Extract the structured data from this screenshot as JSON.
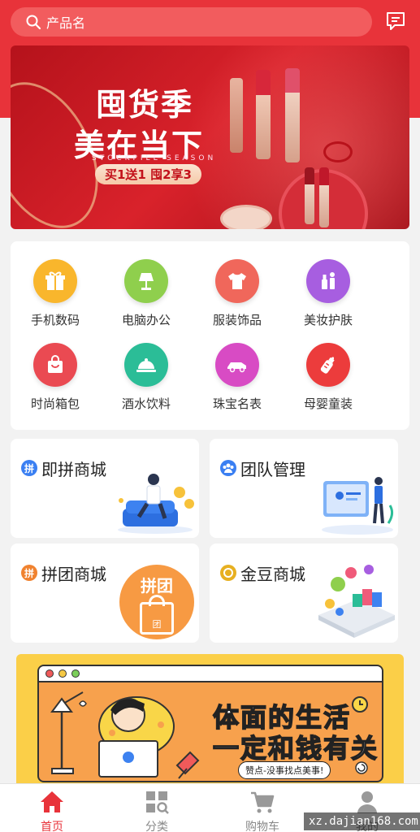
{
  "search": {
    "placeholder": "产品名"
  },
  "banner": {
    "title_line1": "囤货季",
    "title_line2": "美在当下",
    "subtitle": "STOCKPILE SEASON",
    "promo": "买1送1 囤2享3"
  },
  "categories": [
    {
      "label": "手机数码",
      "icon": "gift-icon",
      "color": "#f9b62c"
    },
    {
      "label": "电脑办公",
      "icon": "lamp-icon",
      "color": "#8fcf4d"
    },
    {
      "label": "服装饰品",
      "icon": "tshirt-icon",
      "color": "#f0675b"
    },
    {
      "label": "美妆护肤",
      "icon": "cosmetics-icon",
      "color": "#a75ee0"
    },
    {
      "label": "时尚箱包",
      "icon": "bag-icon",
      "color": "#ea4a52"
    },
    {
      "label": "酒水饮料",
      "icon": "cloche-icon",
      "color": "#2bbd97"
    },
    {
      "label": "珠宝名表",
      "icon": "car-icon",
      "color": "#d84bc4"
    },
    {
      "label": "母婴童装",
      "icon": "bottle-icon",
      "color": "#ec3c3c"
    }
  ],
  "features": [
    {
      "title": "即拼商城",
      "badge": "拼",
      "badge_color": "#3a7ff2"
    },
    {
      "title": "团队管理",
      "badge": "●",
      "badge_color": "#3a7ff2"
    },
    {
      "title": "拼团商城",
      "badge": "拼",
      "badge_color": "#f0822f",
      "illustration_text": "拼团",
      "bag_text": "团"
    },
    {
      "title": "金豆商城",
      "badge": "●",
      "badge_color": "#e7b021"
    }
  ],
  "ad": {
    "line1": "体面的生活",
    "line2": "一定和钱有关",
    "tag": "赞点-没事找点美事!"
  },
  "tabbar": {
    "items": [
      {
        "label": "首页",
        "icon": "home-icon",
        "active": true
      },
      {
        "label": "分类",
        "icon": "category-icon",
        "active": false
      },
      {
        "label": "购物车",
        "icon": "cart-icon",
        "active": false
      },
      {
        "label": "我的",
        "icon": "user-icon",
        "active": false
      }
    ]
  },
  "watermark": "xz.dajian168.com",
  "colors": {
    "brand": "#e8333a"
  }
}
